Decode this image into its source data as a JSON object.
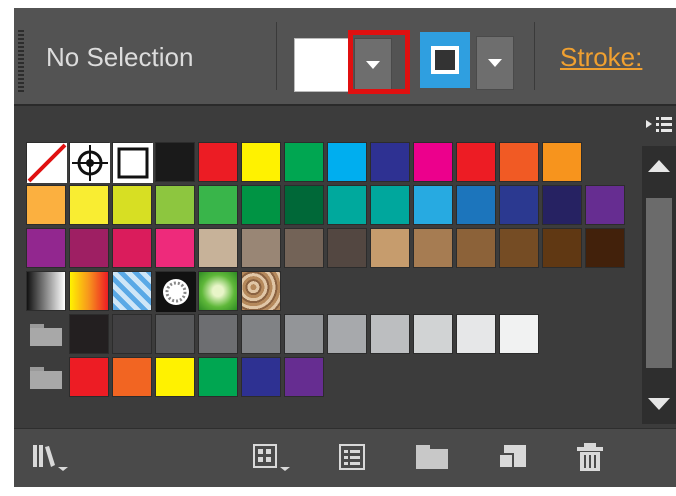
{
  "header": {
    "selection_label": "No Selection",
    "stroke_label": "Stroke:"
  },
  "icons": {
    "fill_dropdown": "chevron-down-icon",
    "stroke_dropdown": "chevron-down-icon",
    "panel_menu": "panel-menu-icon",
    "libraries": "swatch-libraries-icon",
    "show_kinds": "show-swatch-kinds-icon",
    "swatch_options": "swatch-options-icon",
    "new_group": "new-color-group-icon",
    "new_swatch": "new-swatch-icon",
    "delete": "trash-icon"
  },
  "colors": {
    "panel_bg": "#3c3c3c",
    "header_bg": "#535353",
    "highlight": "#e01010",
    "stroke_label": "#f0a030",
    "stroke_swatch": "#2f9fe0"
  },
  "swatch_rows": [
    [
      "none",
      "registration",
      "white",
      "#1a1a1a",
      "#ec1c24",
      "#fff200",
      "#00a651",
      "#00aeef",
      "#2e3192",
      "#ec008c",
      "#ed1c24",
      "#f15a24",
      "#f7941d"
    ],
    [
      "#fbb040",
      "#f9ed32",
      "#d7df23",
      "#8dc63f",
      "#39b54a",
      "#009444",
      "#006838",
      "#00a99d",
      "#00a79d",
      "#27aae1",
      "#1c75bc",
      "#2b3990",
      "#262262",
      "#662d91"
    ],
    [
      "#92278f",
      "#9e1f63",
      "#da1c5c",
      "#ee2a7b",
      "#c7b299",
      "#998675",
      "#736357",
      "#534741",
      "#c69c6d",
      "#a67c52",
      "#8c6239",
      "#754c24",
      "#603813",
      "#42210b"
    ],
    [
      "gradient-bw",
      "gradient-yellow-orange",
      "pattern-blue",
      "pattern-dots",
      "pattern-green",
      "pattern-texture"
    ],
    [
      "folder",
      "#231f20",
      "#414042",
      "#58595b",
      "#6d6e71",
      "#808285",
      "#939598",
      "#a7a9ac",
      "#bcbec0",
      "#d1d3d4",
      "#e6e7e8",
      "#f1f2f2"
    ],
    [
      "folder",
      "#ed1c24",
      "#f26522",
      "#fff200",
      "#00a651",
      "#2e3192",
      "#662d91"
    ]
  ]
}
